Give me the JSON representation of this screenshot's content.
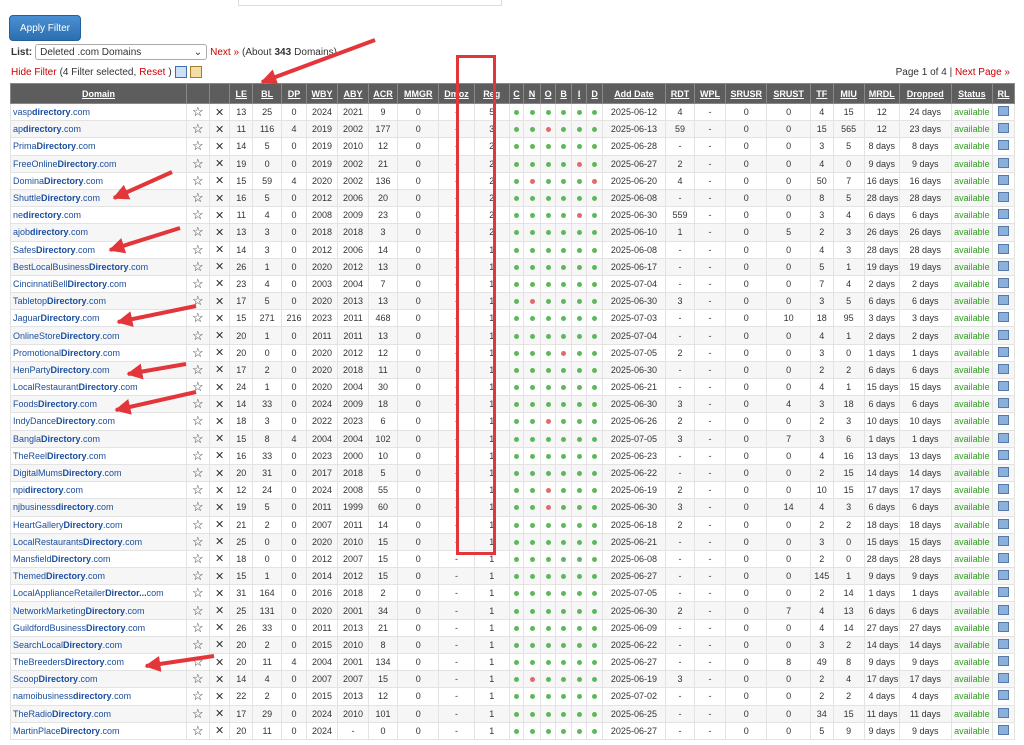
{
  "apply_label": "Apply Filter",
  "list_label": "List:",
  "list_value": "Deleted .com Domains",
  "next_link": "Next »",
  "about_prefix": "(About",
  "about_count": "343",
  "about_suffix": "Domains)",
  "hide_filter": "Hide Filter",
  "filter_info": "(4 Filter selected,",
  "reset": "Reset",
  "close_paren": ")",
  "page_text": "Page 1 of 4 |",
  "next_page": "Next Page »",
  "columns": [
    "Domain",
    "",
    "",
    "LE",
    "BL",
    "DP",
    "WBY",
    "ABY",
    "ACR",
    "MMGR",
    "Dmoz",
    "Reg",
    "C",
    "N",
    "O",
    "B",
    "I",
    "D",
    "Add Date",
    "RDT",
    "WPL",
    "SRUSR",
    "SRUST",
    "TF",
    "MIU",
    "MRDL",
    "Dropped",
    "Status",
    "RL"
  ],
  "status_text": "available",
  "rows": [
    {
      "a": "vasp",
      "b": "directory",
      "c": ".com",
      "le": "13",
      "bl": "25",
      "dp": "0",
      "wby": "2024",
      "aby": "2021",
      "acr": "9",
      "mmgr": "0",
      "dmoz": "-",
      "reg": "5",
      "dots": "gggggg",
      "date": "2025-06-12",
      "rdt": "4",
      "wpl": "-",
      "srusr": "0",
      "srust": "0",
      "tf": "4",
      "miu": "15",
      "mrdl": "12",
      "dropped": "24 days"
    },
    {
      "a": "ap",
      "b": "directory",
      "c": ".com",
      "le": "11",
      "bl": "116",
      "dp": "4",
      "wby": "2019",
      "aby": "2002",
      "acr": "177",
      "mmgr": "0",
      "dmoz": "-",
      "reg": "3",
      "dots": "ggrggg",
      "date": "2025-06-13",
      "rdt": "59",
      "wpl": "-",
      "srusr": "0",
      "srust": "0",
      "tf": "15",
      "miu": "565",
      "mrdl": "12",
      "dropped": "23 days"
    },
    {
      "a": "Prima",
      "b": "Directory",
      "c": ".com",
      "le": "14",
      "bl": "5",
      "dp": "0",
      "wby": "2019",
      "aby": "2010",
      "acr": "12",
      "mmgr": "0",
      "dmoz": "-",
      "reg": "2",
      "dots": "gggggg",
      "date": "2025-06-28",
      "rdt": "-",
      "wpl": "-",
      "srusr": "0",
      "srust": "0",
      "tf": "3",
      "miu": "5",
      "mrdl": "8 days",
      "dropped": "8 days",
      "fix": "1"
    },
    {
      "a": "FreeOnline",
      "b": "Directory",
      "c": ".com",
      "le": "19",
      "bl": "0",
      "dp": "0",
      "wby": "2019",
      "aby": "2002",
      "acr": "21",
      "mmgr": "0",
      "dmoz": "-",
      "reg": "2",
      "dots": "ggggrg",
      "date": "2025-06-27",
      "rdt": "2",
      "wpl": "-",
      "srusr": "0",
      "srust": "0",
      "tf": "4",
      "miu": "0",
      "mrdl": "9 days",
      "dropped": "9 days",
      "fix": "1"
    },
    {
      "a": "Domina",
      "b": "Directory",
      "c": ".com",
      "le": "15",
      "bl": "59",
      "dp": "4",
      "wby": "2020",
      "aby": "2002",
      "acr": "136",
      "mmgr": "0",
      "dmoz": "-",
      "reg": "2",
      "dots": "grgggr",
      "date": "2025-06-20",
      "rdt": "4",
      "wpl": "-",
      "srusr": "0",
      "srust": "0",
      "tf": "50",
      "miu": "7",
      "mrdl": "16 days",
      "dropped": "16 days",
      "fix": "1"
    },
    {
      "a": "Shuttle",
      "b": "Directory",
      "c": ".com",
      "le": "16",
      "bl": "5",
      "dp": "0",
      "wby": "2012",
      "aby": "2006",
      "acr": "20",
      "mmgr": "0",
      "dmoz": "-",
      "reg": "2",
      "dots": "gggggg",
      "date": "2025-06-08",
      "rdt": "-",
      "wpl": "-",
      "srusr": "0",
      "srust": "0",
      "tf": "8",
      "miu": "5",
      "mrdl": "28 days",
      "dropped": "28 days",
      "fix": "1"
    },
    {
      "a": "ne",
      "b": "directory",
      "c": ".com",
      "le": "11",
      "bl": "4",
      "dp": "0",
      "wby": "2008",
      "aby": "2009",
      "acr": "23",
      "mmgr": "0",
      "dmoz": "-",
      "reg": "2",
      "dots": "ggggrg",
      "date": "2025-06-30",
      "rdt": "559",
      "wpl": "-",
      "srusr": "0",
      "srust": "0",
      "tf": "3",
      "miu": "4",
      "mrdl": "6 days",
      "dropped": "6 days",
      "fix": "1"
    },
    {
      "a": "ajob",
      "b": "directory",
      "c": ".com",
      "le": "13",
      "bl": "3",
      "dp": "0",
      "wby": "2018",
      "aby": "2018",
      "acr": "3",
      "mmgr": "0",
      "dmoz": "-",
      "reg": "2",
      "dots": "gggggg",
      "date": "2025-06-10",
      "rdt": "1",
      "wpl": "-",
      "srusr": "0",
      "srust": "5",
      "tf": "2",
      "miu": "3",
      "mrdl": "26 days",
      "dropped": "26 days",
      "fix": "1"
    },
    {
      "a": "Safes",
      "b": "Directory",
      "c": ".com",
      "le": "14",
      "bl": "3",
      "dp": "0",
      "wby": "2012",
      "aby": "2006",
      "acr": "14",
      "mmgr": "0",
      "dmoz": "-",
      "reg": "1",
      "dots": "gggggg",
      "date": "2025-06-08",
      "rdt": "-",
      "wpl": "-",
      "srusr": "0",
      "srust": "0",
      "tf": "4",
      "miu": "3",
      "mrdl": "28 days",
      "dropped": "28 days",
      "fix": "1"
    },
    {
      "a": "BestLocalBusiness",
      "b": "Directory",
      "c": ".com",
      "le": "26",
      "bl": "1",
      "dp": "0",
      "wby": "2020",
      "aby": "2012",
      "acr": "13",
      "mmgr": "0",
      "dmoz": "-",
      "reg": "1",
      "dots": "gggggg",
      "date": "2025-06-17",
      "rdt": "-",
      "wpl": "-",
      "srusr": "0",
      "srust": "0",
      "tf": "5",
      "miu": "1",
      "mrdl": "19 days",
      "dropped": "19 days",
      "fix": "1"
    },
    {
      "a": "CincinnatiBell",
      "b": "Directory",
      "c": ".com",
      "le": "23",
      "bl": "4",
      "dp": "0",
      "wby": "2003",
      "aby": "2004",
      "acr": "7",
      "mmgr": "0",
      "dmoz": "-",
      "reg": "1",
      "dots": "gggggg",
      "date": "2025-07-04",
      "rdt": "-",
      "wpl": "-",
      "srusr": "0",
      "srust": "0",
      "tf": "7",
      "miu": "4",
      "mrdl": "2 days",
      "dropped": "2 days",
      "fix": "1"
    },
    {
      "a": "Tabletop",
      "b": "Directory",
      "c": ".com",
      "le": "17",
      "bl": "5",
      "dp": "0",
      "wby": "2020",
      "aby": "2013",
      "acr": "13",
      "mmgr": "0",
      "dmoz": "-",
      "reg": "1",
      "dots": "grgggg",
      "date": "2025-06-30",
      "rdt": "3",
      "wpl": "-",
      "srusr": "0",
      "srust": "0",
      "tf": "3",
      "miu": "5",
      "mrdl": "6 days",
      "dropped": "6 days",
      "fix": "1"
    },
    {
      "a": "Jaguar",
      "b": "Directory",
      "c": ".com",
      "le": "15",
      "bl": "271",
      "dp": "216",
      "wby": "2023",
      "aby": "2011",
      "acr": "468",
      "mmgr": "0",
      "dmoz": "-",
      "reg": "1",
      "dots": "gggggg",
      "date": "2025-07-03",
      "rdt": "-",
      "wpl": "-",
      "srusr": "0",
      "srust": "10",
      "tf": "18",
      "miu": "95",
      "mrdl": "3 days",
      "dropped": "3 days",
      "fix": "1"
    },
    {
      "a": "OnlineStore",
      "b": "Directory",
      "c": ".com",
      "le": "20",
      "bl": "1",
      "dp": "0",
      "wby": "2011",
      "aby": "2011",
      "acr": "13",
      "mmgr": "0",
      "dmoz": "-",
      "reg": "1",
      "dots": "gggggg",
      "date": "2025-07-04",
      "rdt": "-",
      "wpl": "-",
      "srusr": "0",
      "srust": "0",
      "tf": "4",
      "miu": "1",
      "mrdl": "2 days",
      "dropped": "2 days",
      "fix": "1"
    },
    {
      "a": "Promotional",
      "b": "Directory",
      "c": ".com",
      "le": "20",
      "bl": "0",
      "dp": "0",
      "wby": "2020",
      "aby": "2012",
      "acr": "12",
      "mmgr": "0",
      "dmoz": "-",
      "reg": "1",
      "dots": "gggrgg",
      "date": "2025-07-05",
      "rdt": "2",
      "wpl": "-",
      "srusr": "0",
      "srust": "0",
      "tf": "3",
      "miu": "0",
      "mrdl": "1 days",
      "dropped": "1 days",
      "fix": "1"
    },
    {
      "a": "HenParty",
      "b": "Directory",
      "c": ".com",
      "le": "17",
      "bl": "2",
      "dp": "0",
      "wby": "2020",
      "aby": "2018",
      "acr": "11",
      "mmgr": "0",
      "dmoz": "-",
      "reg": "1",
      "dots": "gggggg",
      "date": "2025-06-30",
      "rdt": "-",
      "wpl": "-",
      "srusr": "0",
      "srust": "0",
      "tf": "2",
      "miu": "2",
      "mrdl": "6 days",
      "dropped": "6 days",
      "fix": "1"
    },
    {
      "a": "LocalRestaurant",
      "b": "Directory",
      "c": ".com",
      "le": "24",
      "bl": "1",
      "dp": "0",
      "wby": "2020",
      "aby": "2004",
      "acr": "30",
      "mmgr": "0",
      "dmoz": "-",
      "reg": "1",
      "dots": "gggggg",
      "date": "2025-06-21",
      "rdt": "-",
      "wpl": "-",
      "srusr": "0",
      "srust": "0",
      "tf": "4",
      "miu": "1",
      "mrdl": "15 days",
      "dropped": "15 days",
      "fix": "1"
    },
    {
      "a": "Foods",
      "b": "Directory",
      "c": ".com",
      "le": "14",
      "bl": "33",
      "dp": "0",
      "wby": "2024",
      "aby": "2009",
      "acr": "18",
      "mmgr": "0",
      "dmoz": "-",
      "reg": "1",
      "dots": "gggggg",
      "date": "2025-06-30",
      "rdt": "3",
      "wpl": "-",
      "srusr": "0",
      "srust": "4",
      "tf": "3",
      "miu": "18",
      "mrdl": "6 days",
      "dropped": "6 days",
      "fix": "1"
    },
    {
      "a": "IndyDance",
      "b": "Directory",
      "c": ".com",
      "le": "18",
      "bl": "3",
      "dp": "0",
      "wby": "2022",
      "aby": "2023",
      "acr": "6",
      "mmgr": "0",
      "dmoz": "-",
      "reg": "1",
      "dots": "ggrggg",
      "date": "2025-06-26",
      "rdt": "2",
      "wpl": "-",
      "srusr": "0",
      "srust": "0",
      "tf": "2",
      "miu": "3",
      "mrdl": "10 days",
      "dropped": "10 days",
      "fix": "1"
    },
    {
      "a": "Bangla",
      "b": "Directory",
      "c": ".com",
      "le": "15",
      "bl": "8",
      "dp": "4",
      "wby": "2004",
      "aby": "2004",
      "acr": "102",
      "mmgr": "0",
      "dmoz": "-",
      "reg": "1",
      "dots": "gggggg",
      "date": "2025-07-05",
      "rdt": "3",
      "wpl": "-",
      "srusr": "0",
      "srust": "7",
      "tf": "3",
      "miu": "6",
      "mrdl": "1 days",
      "dropped": "1 days",
      "fix": "1"
    },
    {
      "a": "TheReel",
      "b": "Directory",
      "c": ".com",
      "le": "16",
      "bl": "33",
      "dp": "0",
      "wby": "2023",
      "aby": "2000",
      "acr": "10",
      "mmgr": "0",
      "dmoz": "-",
      "reg": "1",
      "dots": "gggggg",
      "date": "2025-06-23",
      "rdt": "-",
      "wpl": "-",
      "srusr": "0",
      "srust": "0",
      "tf": "4",
      "miu": "16",
      "mrdl": "13 days",
      "dropped": "13 days",
      "fix": "1"
    },
    {
      "a": "DigitalMums",
      "b": "Directory",
      "c": ".com",
      "le": "20",
      "bl": "31",
      "dp": "0",
      "wby": "2017",
      "aby": "2018",
      "acr": "5",
      "mmgr": "0",
      "dmoz": "-",
      "reg": "1",
      "dots": "gggggg",
      "date": "2025-06-22",
      "rdt": "-",
      "wpl": "-",
      "srusr": "0",
      "srust": "0",
      "tf": "2",
      "miu": "15",
      "mrdl": "14 days",
      "dropped": "14 days",
      "fix": "1"
    },
    {
      "a": "npi",
      "b": "directory",
      "c": ".com",
      "le": "12",
      "bl": "24",
      "dp": "0",
      "wby": "2024",
      "aby": "2008",
      "acr": "55",
      "mmgr": "0",
      "dmoz": "-",
      "reg": "1",
      "dots": "ggrggg",
      "date": "2025-06-19",
      "rdt": "2",
      "wpl": "-",
      "srusr": "0",
      "srust": "0",
      "tf": "10",
      "miu": "15",
      "mrdl": "17 days",
      "dropped": "17 days",
      "fix": "1"
    },
    {
      "a": "njbusiness",
      "b": "directory",
      "c": ".com",
      "le": "19",
      "bl": "5",
      "dp": "0",
      "wby": "2011",
      "aby": "1999",
      "acr": "60",
      "mmgr": "0",
      "dmoz": "-",
      "reg": "1",
      "dots": "ggrggg",
      "date": "2025-06-30",
      "rdt": "3",
      "wpl": "-",
      "srusr": "0",
      "srust": "14",
      "tf": "4",
      "miu": "3",
      "mrdl": "6 days",
      "dropped": "6 days",
      "fix": "1"
    },
    {
      "a": "HeartGallery",
      "b": "Directory",
      "c": ".com",
      "le": "21",
      "bl": "2",
      "dp": "0",
      "wby": "2007",
      "aby": "2011",
      "acr": "14",
      "mmgr": "0",
      "dmoz": "-",
      "reg": "1",
      "dots": "gggggg",
      "date": "2025-06-18",
      "rdt": "2",
      "wpl": "-",
      "srusr": "0",
      "srust": "0",
      "tf": "2",
      "miu": "2",
      "mrdl": "18 days",
      "dropped": "18 days",
      "fix": "1"
    },
    {
      "a": "LocalRestaurants",
      "b": "Directory",
      "c": ".com",
      "le": "25",
      "bl": "0",
      "dp": "0",
      "wby": "2020",
      "aby": "2010",
      "acr": "15",
      "mmgr": "0",
      "dmoz": "-",
      "reg": "1",
      "dots": "gggggg",
      "date": "2025-06-21",
      "rdt": "-",
      "wpl": "-",
      "srusr": "0",
      "srust": "0",
      "tf": "3",
      "miu": "0",
      "mrdl": "15 days",
      "dropped": "15 days",
      "fix": "1"
    },
    {
      "a": "Mansfield",
      "b": "Directory",
      "c": ".com",
      "le": "18",
      "bl": "0",
      "dp": "0",
      "wby": "2012",
      "aby": "2007",
      "acr": "15",
      "mmgr": "0",
      "dmoz": "-",
      "reg": "1",
      "dots": "gggggg",
      "date": "2025-06-08",
      "rdt": "-",
      "wpl": "-",
      "srusr": "0",
      "srust": "0",
      "tf": "2",
      "miu": "0",
      "mrdl": "28 days",
      "dropped": "28 days",
      "fix": "1"
    },
    {
      "a": "Themed",
      "b": "Directory",
      "c": ".com",
      "le": "15",
      "bl": "1",
      "dp": "0",
      "wby": "2014",
      "aby": "2012",
      "acr": "15",
      "mmgr": "0",
      "dmoz": "-",
      "reg": "1",
      "dots": "gggggg",
      "date": "2025-06-27",
      "rdt": "-",
      "wpl": "-",
      "srusr": "0",
      "srust": "0",
      "tf": "145",
      "miu": "1",
      "mrdl": "9 days",
      "dropped": "9 days",
      "fix": "1"
    },
    {
      "a": "LocalApplianceRetailer",
      "b": "Director...",
      "c": "com",
      "le": "31",
      "bl": "164",
      "dp": "0",
      "wby": "2016",
      "aby": "2018",
      "acr": "2",
      "mmgr": "0",
      "dmoz": "-",
      "reg": "1",
      "dots": "gggggg",
      "date": "2025-07-05",
      "rdt": "-",
      "wpl": "-",
      "srusr": "0",
      "srust": "0",
      "tf": "2",
      "miu": "14",
      "mrdl": "1 days",
      "dropped": "1 days",
      "fix": "1"
    },
    {
      "a": "NetworkMarketing",
      "b": "Directory",
      "c": ".com",
      "le": "25",
      "bl": "131",
      "dp": "0",
      "wby": "2020",
      "aby": "2001",
      "acr": "34",
      "mmgr": "0",
      "dmoz": "-",
      "reg": "1",
      "dots": "gggggg",
      "date": "2025-06-30",
      "rdt": "2",
      "wpl": "-",
      "srusr": "0",
      "srust": "7",
      "tf": "4",
      "miu": "13",
      "mrdl": "6 days",
      "dropped": "6 days",
      "fix": "1"
    },
    {
      "a": "GuildfordBusiness",
      "b": "Directory",
      "c": ".com",
      "le": "26",
      "bl": "33",
      "dp": "0",
      "wby": "2011",
      "aby": "2013",
      "acr": "21",
      "mmgr": "0",
      "dmoz": "-",
      "reg": "1",
      "dots": "gggggg",
      "date": "2025-06-09",
      "rdt": "-",
      "wpl": "-",
      "srusr": "0",
      "srust": "0",
      "tf": "4",
      "miu": "14",
      "mrdl": "27 days",
      "dropped": "27 days",
      "fix": "1"
    },
    {
      "a": "SearchLocal",
      "b": "Directory",
      "c": ".com",
      "le": "20",
      "bl": "2",
      "dp": "0",
      "wby": "2015",
      "aby": "2010",
      "acr": "8",
      "mmgr": "0",
      "dmoz": "-",
      "reg": "1",
      "dots": "gggggg",
      "date": "2025-06-22",
      "rdt": "-",
      "wpl": "-",
      "srusr": "0",
      "srust": "0",
      "tf": "3",
      "miu": "2",
      "mrdl": "14 days",
      "dropped": "14 days",
      "fix": "1"
    },
    {
      "a": "TheBreeders",
      "b": "Directory",
      "c": ".com",
      "le": "20",
      "bl": "11",
      "dp": "4",
      "wby": "2004",
      "aby": "2001",
      "acr": "134",
      "mmgr": "0",
      "dmoz": "-",
      "reg": "1",
      "dots": "gggggg",
      "date": "2025-06-27",
      "rdt": "-",
      "wpl": "-",
      "srusr": "0",
      "srust": "8",
      "tf": "49",
      "miu": "8",
      "mrdl": "9 days",
      "dropped": "9 days",
      "fix": "1"
    },
    {
      "a": "Scoop",
      "b": "Directory",
      "c": ".com",
      "le": "14",
      "bl": "4",
      "dp": "0",
      "wby": "2007",
      "aby": "2007",
      "acr": "15",
      "mmgr": "0",
      "dmoz": "-",
      "reg": "1",
      "dots": "grgggg",
      "date": "2025-06-19",
      "rdt": "3",
      "wpl": "-",
      "srusr": "0",
      "srust": "0",
      "tf": "2",
      "miu": "4",
      "mrdl": "17 days",
      "dropped": "17 days",
      "fix": "1"
    },
    {
      "a": "namoibusiness",
      "b": "directory",
      "c": ".com",
      "le": "22",
      "bl": "2",
      "dp": "0",
      "wby": "2015",
      "aby": "2013",
      "acr": "12",
      "mmgr": "0",
      "dmoz": "-",
      "reg": "1",
      "dots": "gggggg",
      "date": "2025-07-02",
      "rdt": "-",
      "wpl": "-",
      "srusr": "0",
      "srust": "0",
      "tf": "2",
      "miu": "2",
      "mrdl": "4 days",
      "dropped": "4 days",
      "fix": "1"
    },
    {
      "a": "TheRadio",
      "b": "Directory",
      "c": ".com",
      "le": "17",
      "bl": "29",
      "dp": "0",
      "wby": "2024",
      "aby": "2010",
      "acr": "101",
      "mmgr": "0",
      "dmoz": "-",
      "reg": "1",
      "dots": "gggggg",
      "date": "2025-06-25",
      "rdt": "-",
      "wpl": "-",
      "srusr": "0",
      "srust": "0",
      "tf": "34",
      "miu": "15",
      "mrdl": "11 days",
      "dropped": "11 days",
      "fix": "1"
    },
    {
      "a": "MartinPlace",
      "b": "Directory",
      "c": ".com",
      "le": "20",
      "bl": "11",
      "dp": "0",
      "wby": "2024",
      "aby": "-",
      "acr": "0",
      "mmgr": "0",
      "dmoz": "-",
      "reg": "1",
      "dots": "gggggg",
      "date": "2025-06-27",
      "rdt": "-",
      "wpl": "-",
      "srusr": "0",
      "srust": "0",
      "tf": "5",
      "miu": "9",
      "mrdl": "9 days",
      "dropped": "9 days",
      "fix": "1"
    }
  ]
}
